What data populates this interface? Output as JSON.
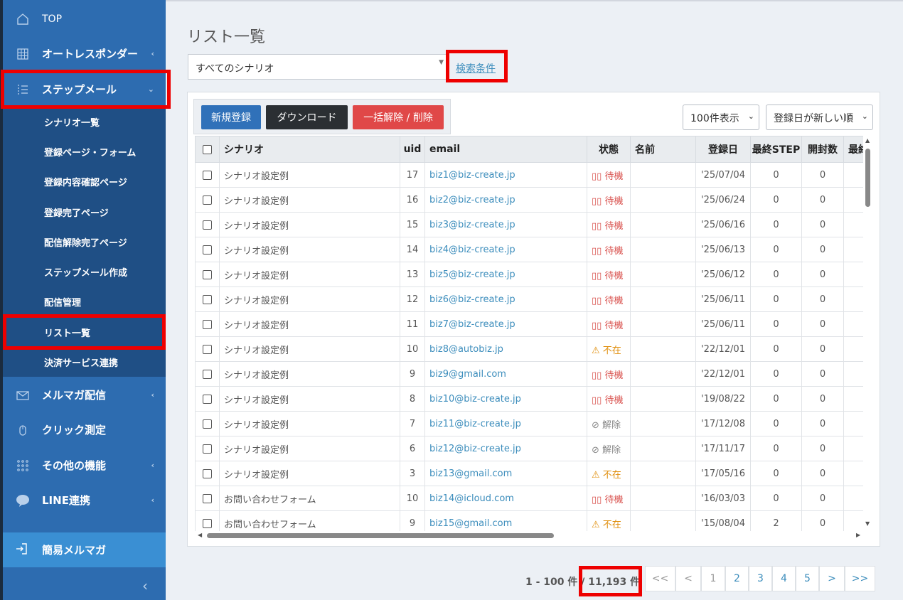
{
  "sidebar": {
    "top": "TOP",
    "autoresponder": "オートレスポンダー",
    "stepmail": "ステップメール",
    "submenu": [
      "シナリオ一覧",
      "登録ページ・フォーム",
      "登録内容確認ページ",
      "登録完了ページ",
      "配信解除完了ページ",
      "ステップメール作成",
      "配信管理",
      "リスト一覧",
      "決済サービス連携"
    ],
    "mailmag": "メルマガ配信",
    "click": "クリック測定",
    "other": "その他の機能",
    "line": "LINE連携",
    "simple": "簡易メルマガ"
  },
  "page": {
    "title": "リスト一覧",
    "scenario_select": "すべてのシナリオ",
    "search_link": "検索条件"
  },
  "toolbar": {
    "new": "新規登録",
    "download": "ダウンロード",
    "bulk": "一括解除 / 削除",
    "per_page": "100件表示",
    "sort": "登録日が新しい順"
  },
  "table": {
    "headers": [
      "シナリオ",
      "uid",
      "email",
      "状態",
      "名前",
      "登録日",
      "最終STEP",
      "開封数",
      "最終"
    ],
    "rows": [
      {
        "scenario": "シナリオ設定例",
        "uid": "17",
        "email": "biz1@biz-create.jp",
        "status": "待機",
        "status_type": "wait",
        "date": "'25/07/04",
        "step": "0",
        "open": "0"
      },
      {
        "scenario": "シナリオ設定例",
        "uid": "16",
        "email": "biz2@biz-create.jp",
        "status": "待機",
        "status_type": "wait",
        "date": "'25/06/24",
        "step": "0",
        "open": "0"
      },
      {
        "scenario": "シナリオ設定例",
        "uid": "15",
        "email": "biz3@biz-create.jp",
        "status": "待機",
        "status_type": "wait",
        "date": "'25/06/16",
        "step": "0",
        "open": "0"
      },
      {
        "scenario": "シナリオ設定例",
        "uid": "14",
        "email": "biz4@biz-create.jp",
        "status": "待機",
        "status_type": "wait",
        "date": "'25/06/13",
        "step": "0",
        "open": "0"
      },
      {
        "scenario": "シナリオ設定例",
        "uid": "13",
        "email": "biz5@biz-create.jp",
        "status": "待機",
        "status_type": "wait",
        "date": "'25/06/12",
        "step": "0",
        "open": "0"
      },
      {
        "scenario": "シナリオ設定例",
        "uid": "12",
        "email": "biz6@biz-create.jp",
        "status": "待機",
        "status_type": "wait",
        "date": "'25/06/11",
        "step": "0",
        "open": "0"
      },
      {
        "scenario": "シナリオ設定例",
        "uid": "11",
        "email": "biz7@biz-create.jp",
        "status": "待機",
        "status_type": "wait",
        "date": "'25/06/11",
        "step": "0",
        "open": "0"
      },
      {
        "scenario": "シナリオ設定例",
        "uid": "10",
        "email": "biz8@autobiz.jp",
        "status": "不在",
        "status_type": "absent",
        "date": "'22/12/01",
        "step": "0",
        "open": "0"
      },
      {
        "scenario": "シナリオ設定例",
        "uid": "9",
        "email": "biz9@gmail.com",
        "status": "待機",
        "status_type": "wait",
        "date": "'22/12/01",
        "step": "0",
        "open": "0"
      },
      {
        "scenario": "シナリオ設定例",
        "uid": "8",
        "email": "biz10@biz-create.jp",
        "status": "待機",
        "status_type": "wait",
        "date": "'19/08/22",
        "step": "0",
        "open": "0"
      },
      {
        "scenario": "シナリオ設定例",
        "uid": "7",
        "email": "biz11@biz-create.jp",
        "status": "解除",
        "status_type": "cancel",
        "date": "'17/12/08",
        "step": "0",
        "open": "0"
      },
      {
        "scenario": "シナリオ設定例",
        "uid": "6",
        "email": "biz12@biz-create.jp",
        "status": "解除",
        "status_type": "cancel",
        "date": "'17/11/17",
        "step": "0",
        "open": "0"
      },
      {
        "scenario": "シナリオ設定例",
        "uid": "3",
        "email": "biz13@gmail.com",
        "status": "不在",
        "status_type": "absent",
        "date": "'17/05/16",
        "step": "0",
        "open": "0"
      },
      {
        "scenario": "お問い合わせフォーム",
        "uid": "10",
        "email": "biz14@icloud.com",
        "status": "待機",
        "status_type": "wait",
        "date": "'16/03/03",
        "step": "0",
        "open": "0"
      },
      {
        "scenario": "お問い合わせフォーム",
        "uid": "9",
        "email": "biz15@gmail.com",
        "status": "不在",
        "status_type": "absent",
        "date": "'15/08/04",
        "step": "2",
        "open": "0"
      }
    ]
  },
  "pagination": {
    "range": "1 - 100 件 /",
    "total": "11,193 件",
    "first": "<<",
    "prev": "<",
    "pages": [
      "1",
      "2",
      "3",
      "4",
      "5"
    ],
    "next": ">",
    "last": ">>"
  },
  "colors": {
    "sidebar": "#2d6cb0",
    "submenu": "#1f4f85",
    "highlight_box": "#ee0000",
    "btn_new": "#3071b9",
    "btn_download": "#2b2f33",
    "btn_bulk": "#e04848"
  }
}
